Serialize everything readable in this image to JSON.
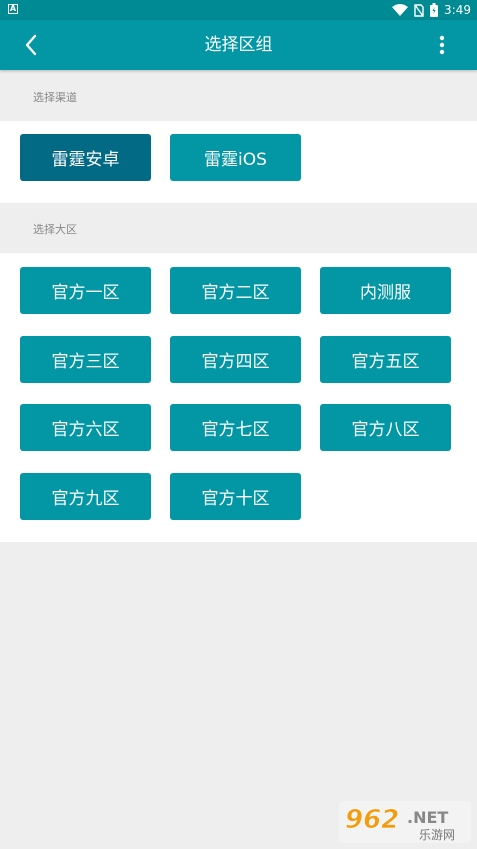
{
  "status_bar": {
    "left_badge": "A",
    "time": "3:49",
    "icons": [
      "wifi-icon",
      "sim-off-icon",
      "battery-icon"
    ]
  },
  "app_bar": {
    "title": "选择区组",
    "back_icon": "chevron-left-icon",
    "menu_icon": "more-vertical-icon"
  },
  "channel_section": {
    "label": "选择渠道",
    "options": [
      "雷霆安卓",
      "雷霆iOS"
    ],
    "selected": "雷霆安卓"
  },
  "region_section": {
    "label": "选择大区",
    "options": [
      "官方一区",
      "官方二区",
      "内测服",
      "官方三区",
      "官方四区",
      "官方五区",
      "官方六区",
      "官方七区",
      "官方八区",
      "官方九区",
      "官方十区"
    ]
  },
  "watermark": {
    "brand": "962",
    "suffix": ".NET",
    "subtitle": "乐游网"
  },
  "colors": {
    "app_bar": "#0397a6",
    "status_bar": "#008a94",
    "button": "#0397a6",
    "button_selected": "#036a86",
    "background": "#eeeeee"
  }
}
